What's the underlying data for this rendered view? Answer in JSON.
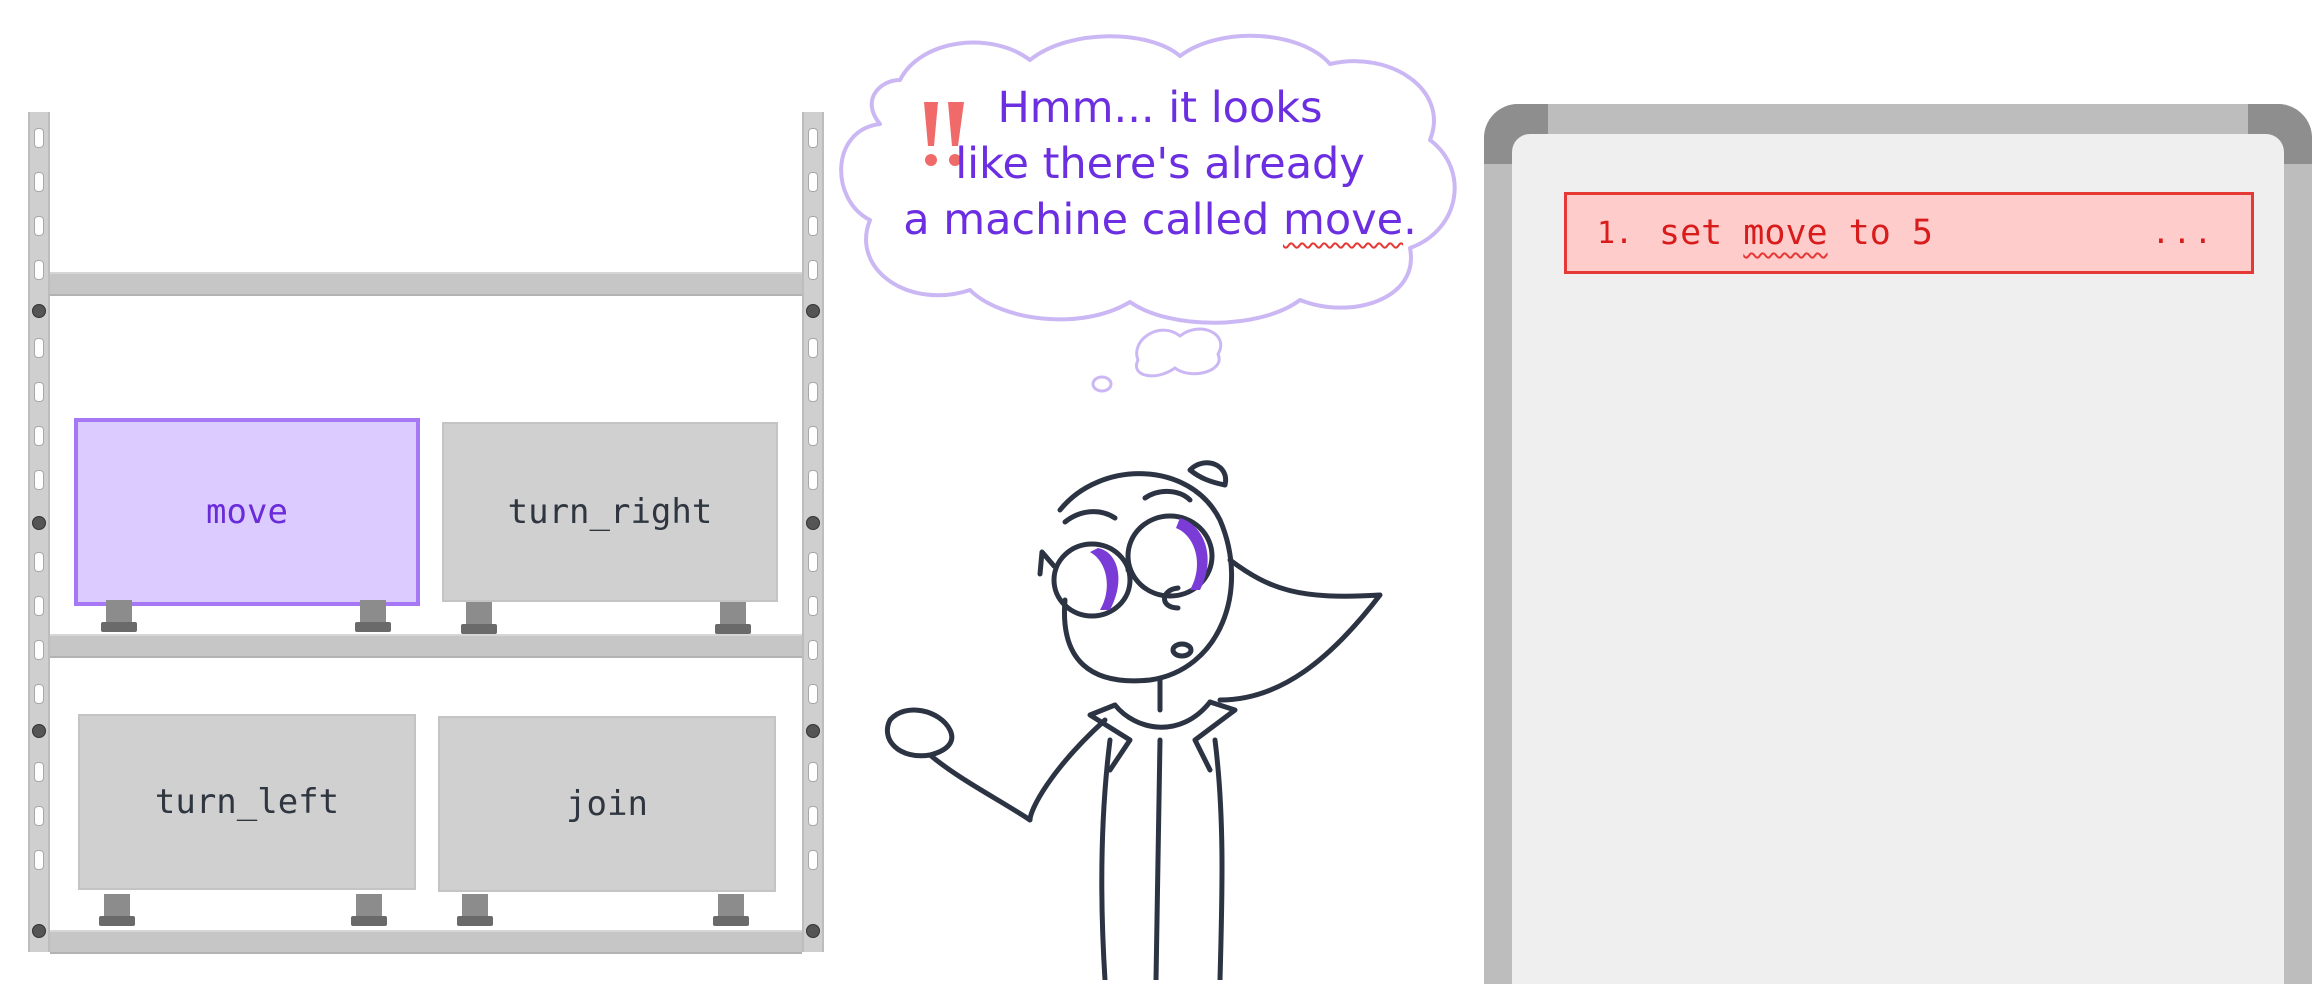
{
  "shelf": {
    "machines": [
      {
        "label": "move",
        "highlighted": true
      },
      {
        "label": "turn_right",
        "highlighted": false
      },
      {
        "label": "turn_left",
        "highlighted": false
      },
      {
        "label": "join",
        "highlighted": false
      }
    ]
  },
  "thought": {
    "line1": "Hmm... it looks",
    "line2": "like there's already",
    "line3_prefix": "a machine called ",
    "line3_keyword": "move",
    "line3_suffix": "."
  },
  "whiteboard": {
    "lines": [
      {
        "number": "1.",
        "code_prefix": "set ",
        "code_keyword": "move",
        "code_suffix": " to 5",
        "menu": "...",
        "status": "error"
      }
    ]
  },
  "colors": {
    "highlight_fill": "#dccbff",
    "highlight_border": "#a678f5",
    "thought_text": "#6b2ee0",
    "error_red": "#e53935",
    "error_fill": "#ffcccc"
  },
  "icons": [
    "exclamation-icon",
    "ellipsis-menu-icon"
  ]
}
